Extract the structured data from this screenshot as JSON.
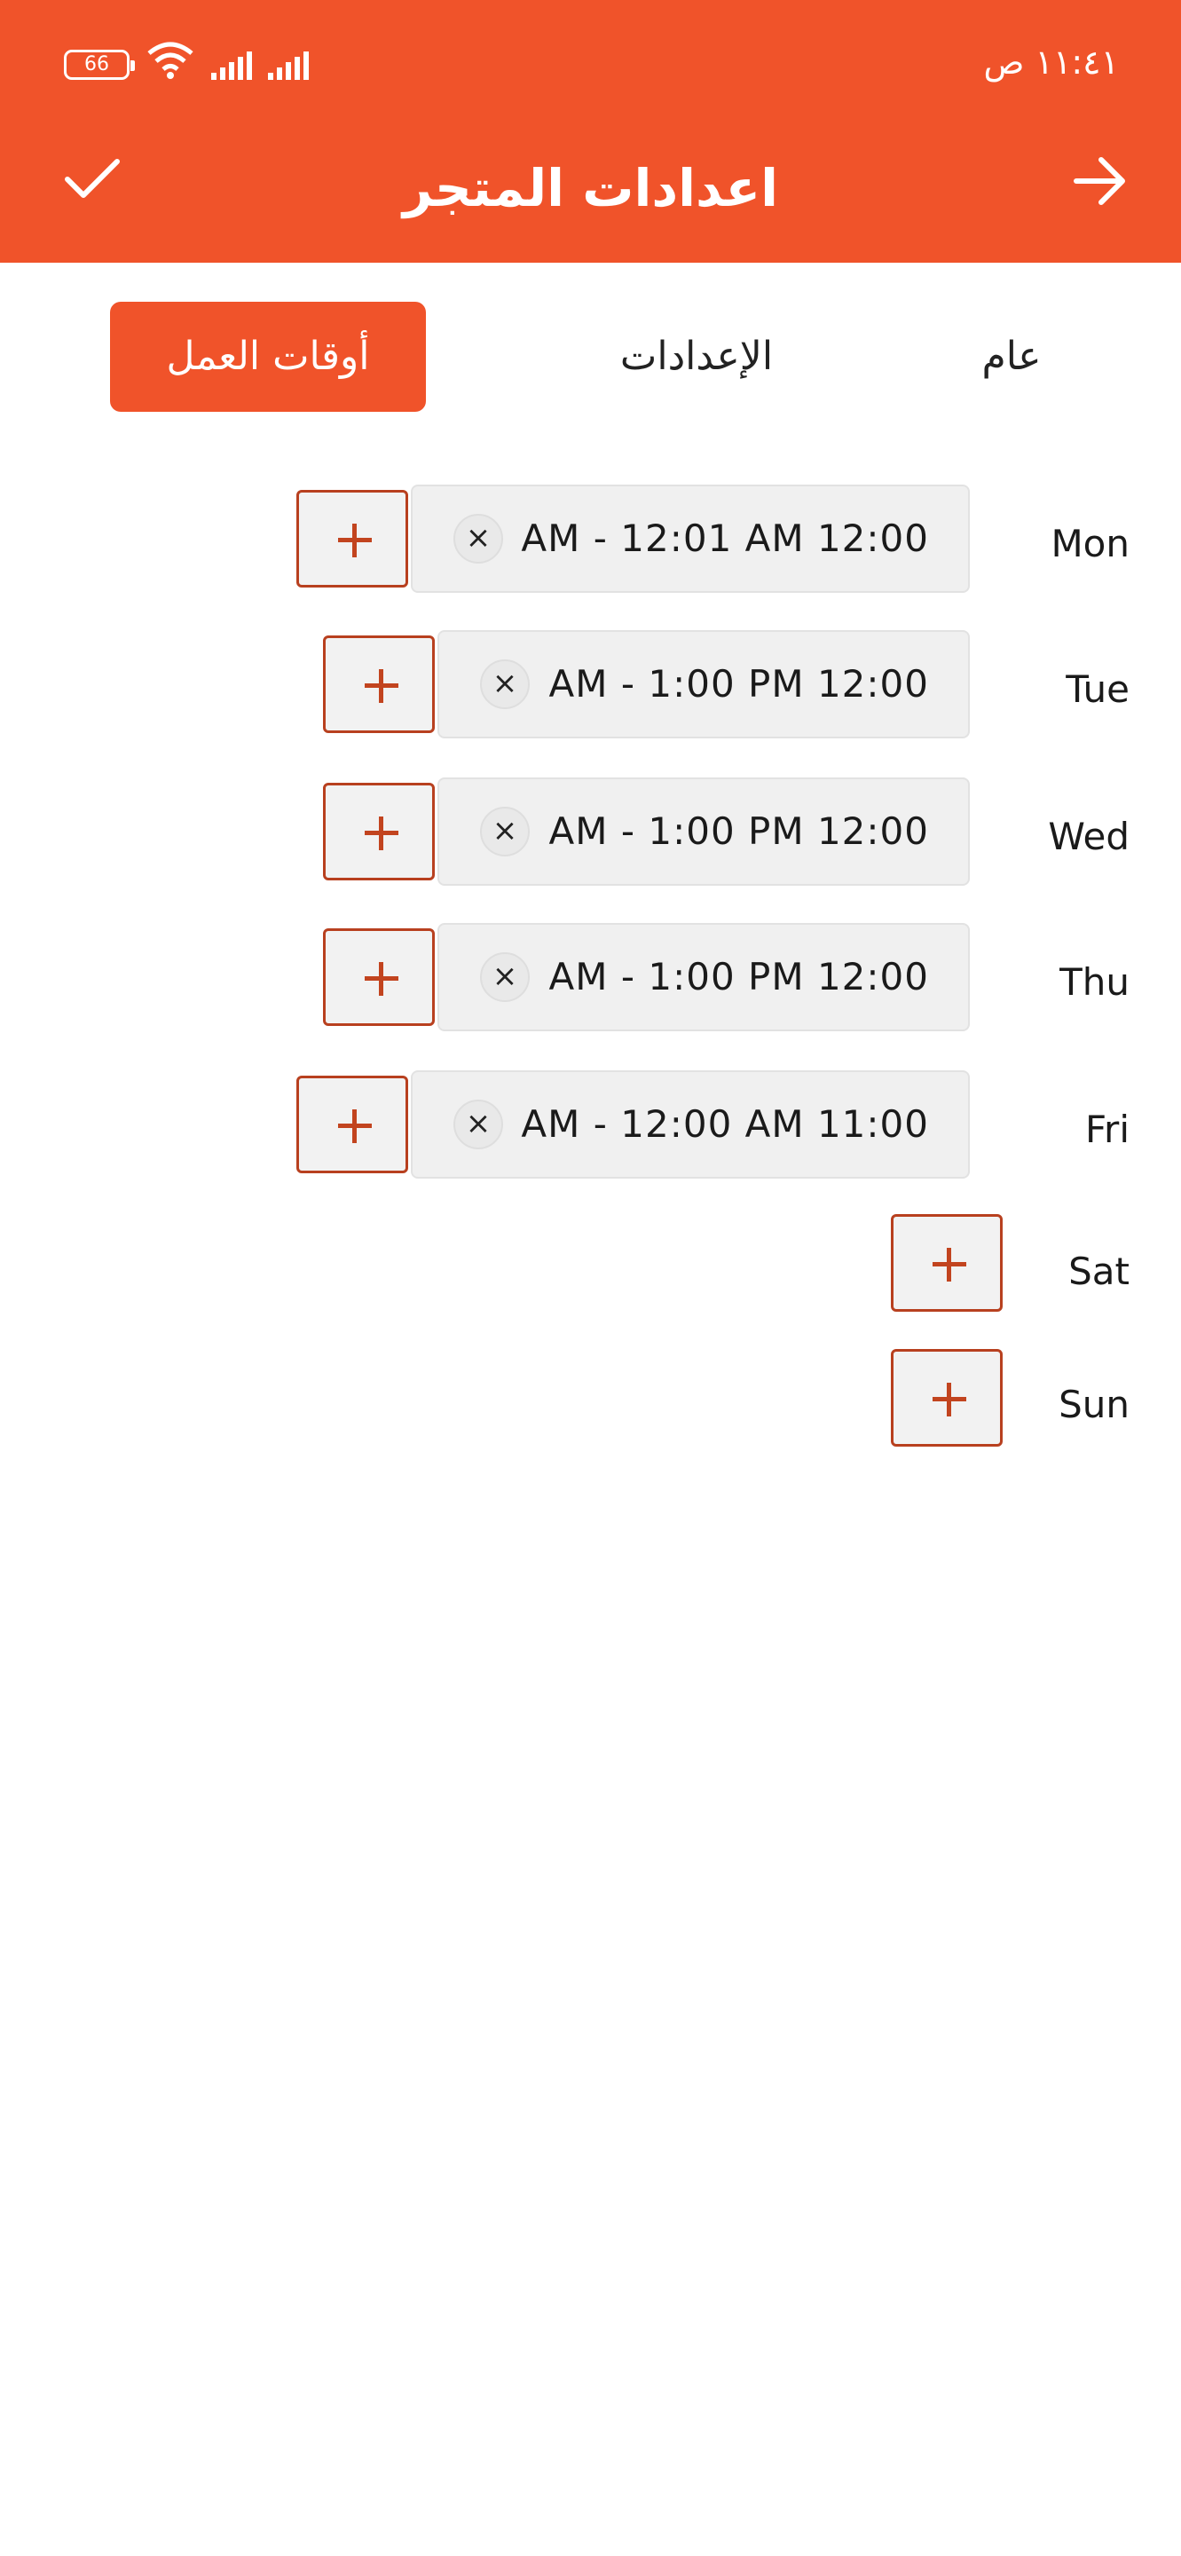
{
  "status_bar": {
    "time": "١١:٤١ ص",
    "battery": "66"
  },
  "app_bar": {
    "title": "اعدادات المتجر",
    "check_icon": "check-icon",
    "back_icon": "arrow-right-icon"
  },
  "tabs": [
    {
      "label": "أوقات العمل",
      "active": true
    },
    {
      "label": "الإعدادات",
      "active": false
    },
    {
      "label": "عام",
      "active": false
    }
  ],
  "schedule": [
    {
      "day": "Mon",
      "slot": "AM - 12:01 AM 12:00"
    },
    {
      "day": "Tue",
      "slot": "AM - 1:00 PM 12:00"
    },
    {
      "day": "Wed",
      "slot": "AM - 1:00 PM 12:00"
    },
    {
      "day": "Thu",
      "slot": "AM - 1:00 PM 12:00"
    },
    {
      "day": "Fri",
      "slot": "AM - 12:00 AM 11:00"
    },
    {
      "day": "Sat"
    },
    {
      "day": "Sun"
    }
  ],
  "icons": {
    "remove": "close-icon",
    "add": "plus-icon"
  },
  "colors": {
    "accent": "#f0532a",
    "add_border": "#b8401f",
    "slot_bg": "#f0f0f0"
  }
}
